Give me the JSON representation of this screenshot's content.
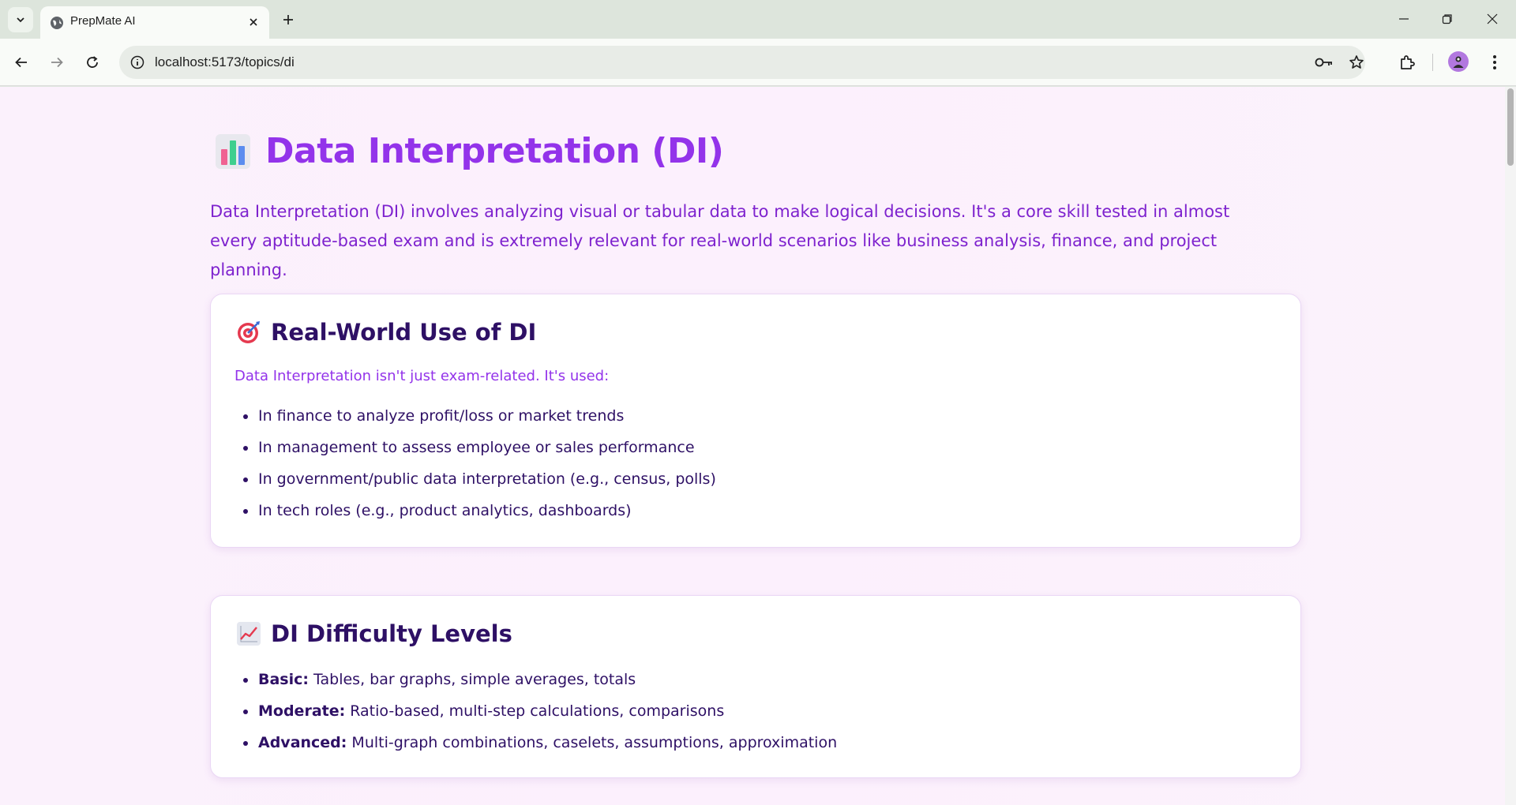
{
  "browser": {
    "tab_title": "PrepMate AI",
    "url": "localhost:5173/topics/di"
  },
  "page": {
    "title": "Data Interpretation (DI)",
    "intro": "Data Interpretation (DI) involves analyzing visual or tabular data to make logical decisions. It's a core skill tested in almost every aptitude-based exam and is extremely relevant for real-world scenarios like business analysis, finance, and project planning.",
    "sections": [
      {
        "heading": "Real-World Use of DI",
        "icon": "target-icon",
        "subtitle": "Data Interpretation isn't just exam-related. It's used:",
        "items": [
          "In finance to analyze profit/loss or market trends",
          "In management to assess employee or sales performance",
          "In government/public data interpretation (e.g., census, polls)",
          "In tech roles (e.g., product analytics, dashboards)"
        ]
      },
      {
        "heading": "DI Difficulty Levels",
        "icon": "chart-increasing-icon",
        "items": [
          {
            "label": "Basic:",
            "text": " Tables, bar graphs, simple averages, totals"
          },
          {
            "label": "Moderate:",
            "text": " Ratio-based, multi-step calculations, comparisons"
          },
          {
            "label": "Advanced:",
            "text": " Multi-graph combinations, caselets, assumptions, approximation"
          }
        ]
      }
    ]
  },
  "colors": {
    "title": "#9333ea",
    "intro": "#7e22ce",
    "heading": "#2e1065",
    "background": "#fcf0fd"
  }
}
